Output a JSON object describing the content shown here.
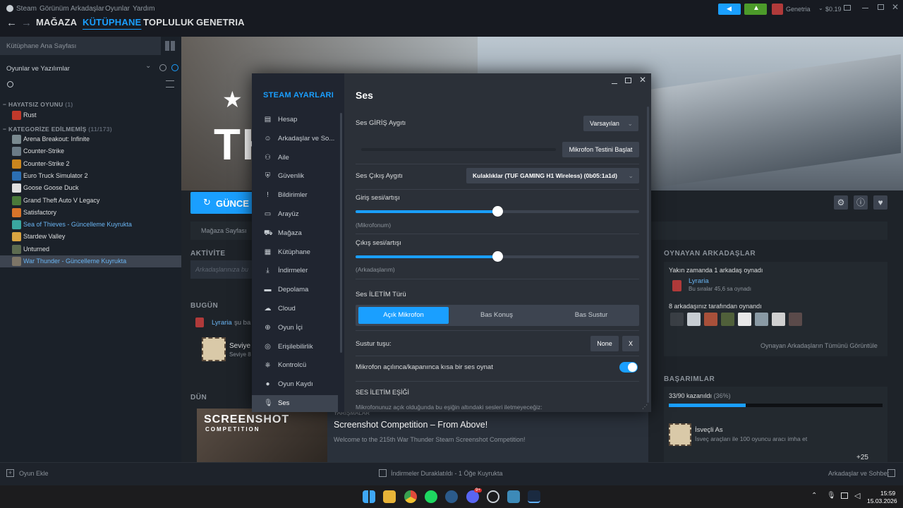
{
  "menubar": {
    "items": [
      "Steam",
      "Görünüm",
      "Arkadaşlar",
      "Oyunlar",
      "Yardım"
    ],
    "user": "Genetria",
    "balance": "$0.19"
  },
  "nav": {
    "back": "←",
    "forward": "→",
    "tabs": [
      "MAĞAZA",
      "KÜTÜPHANE",
      "TOPLULUK",
      "GENETRIA"
    ],
    "active_tab": "KÜTÜPHANE"
  },
  "sidebar": {
    "home": "Kütüphane Ana Sayfası",
    "filter": "Oyunlar ve Yazılımlar",
    "cat1": "HAYATSIZ OYUNU",
    "cat1_count": "(1)",
    "cat2": "KATEGORİZE EDİLMEMİŞ",
    "cat2_count": "(11/173)",
    "games": [
      {
        "name": "Rust",
        "status": "",
        "color": "#c0392b"
      },
      {
        "name": "Arena Breakout: Infinite",
        "status": "",
        "color": "#7a8a90"
      },
      {
        "name": "Counter-Strike",
        "status": "",
        "color": "#6b7b86"
      },
      {
        "name": "Counter-Strike 2",
        "status": "",
        "color": "#c9851e"
      },
      {
        "name": "Euro Truck Simulator 2",
        "status": "",
        "color": "#2c6fb3"
      },
      {
        "name": "Goose Goose Duck",
        "status": "",
        "color": "#e0e0e0"
      },
      {
        "name": "Grand Theft Auto V Legacy",
        "status": "",
        "color": "#4a7a3a"
      },
      {
        "name": "Satisfactory",
        "status": "",
        "color": "#d7742a"
      },
      {
        "name": "Sea of Thieves",
        "status": " - Güncelleme Kuyrukta",
        "color": "#3aa7a0"
      },
      {
        "name": "Stardew Valley",
        "status": "",
        "color": "#d9a441"
      },
      {
        "name": "Unturned",
        "status": "",
        "color": "#5d6b50"
      },
      {
        "name": "War Thunder",
        "status": " - Güncelleme Kuyrukta",
        "color": "#7d7567"
      }
    ]
  },
  "hero": {
    "title_partial": "TH",
    "update_button": "GÜNCE",
    "store_page": "Mağaza Sayfası",
    "activity": "AKTİVİTE",
    "activity_placeholder": "Arkadaşlarınıza bu",
    "today": "BUGÜN",
    "today_user": "Lyraria",
    "today_text": "şu ba",
    "today_item": "Seviye",
    "today_item_sub": "Seviye 8",
    "yesterday": "DÜN",
    "event_tag": "YARIŞMALAR",
    "event_title": "Screenshot Competition – From Above!",
    "event_desc": "Welcome to the 215th War Thunder Steam Screenshot Competition!",
    "event_img_title": "SCREENSHOT",
    "event_img_sub": "COMPETITION"
  },
  "friends_panel": {
    "title": "OYNAYAN ARKADAŞLAR",
    "recent": "Yakın zamanda 1 arkadaş oynadı",
    "friend_name": "Lyraria",
    "friend_sub": "Bu sıralar 45,6 sa oynadı",
    "played_by": "8 arkadaşınız tarafından oynandı",
    "view_all": "Oynayan Arkadaşların Tümünü Görüntüle",
    "avatar_colors": [
      "#3a3f45",
      "#c7cdd3",
      "#a8503a",
      "#50603a",
      "#e8e8e8",
      "#8a9aa5",
      "#d0d0d0",
      "#5a4a4a"
    ]
  },
  "achievements": {
    "title": "BAŞARIMLAR",
    "progress_text": "33/90 kazanıldı",
    "progress_pct": "(36%)",
    "progress": 0.36,
    "latest_name": "İsveçli As",
    "latest_desc": "İsveç araçları ile 100 oyuncu aracı imha et",
    "more": "+25"
  },
  "settings": {
    "title": "STEAM AYARLARI",
    "nav": [
      {
        "label": "Hesap",
        "icon": "▤"
      },
      {
        "label": "Arkadaşlar ve So...",
        "icon": "☺"
      },
      {
        "label": "Aile",
        "icon": "⚇"
      },
      {
        "label": "Güvenlik",
        "icon": "⛨"
      },
      {
        "label": "Bildirimler",
        "icon": "!"
      },
      {
        "label": "Arayüz",
        "icon": "▭"
      },
      {
        "label": "Mağaza",
        "icon": "⛟"
      },
      {
        "label": "Kütüphane",
        "icon": "▦"
      },
      {
        "label": "İndirmeler",
        "icon": "⤓"
      },
      {
        "label": "Depolama",
        "icon": "▬"
      },
      {
        "label": "Cloud",
        "icon": "☁"
      },
      {
        "label": "Oyun İçi",
        "icon": "⊕"
      },
      {
        "label": "Erişilebilirlik",
        "icon": "◎"
      },
      {
        "label": "Kontrolcü",
        "icon": "⎈"
      },
      {
        "label": "Oyun Kaydı",
        "icon": "●"
      },
      {
        "label": "Ses",
        "icon": "🎙"
      }
    ],
    "page_title": "Ses",
    "input_device_label": "Ses GİRİŞ Aygıtı",
    "input_device_value": "Varsayılan",
    "mic_test_button": "Mikrofon Testini Başlat",
    "output_device_label": "Ses Çıkış Aygıtı",
    "output_device_value": "Kulaklıklar (TUF GAMING H1 Wireless) (0b05:1a1d)",
    "input_volume_label": "Giriş sesi/artışı",
    "input_volume_sub": "(Mikrofonum)",
    "input_volume": 0.5,
    "output_volume_label": "Çıkış sesi/artışı",
    "output_volume_sub": "(Arkadaşlarım)",
    "output_volume": 0.5,
    "transmission_label": "Ses İLETİM Türü",
    "transmission_options": [
      "Açık Mikrofon",
      "Bas Konuş",
      "Bas Sustur"
    ],
    "transmission_selected": "Açık Mikrofon",
    "mute_key_label": "Sustur tuşu:",
    "mute_key_value": "None",
    "mute_key_clear": "X",
    "mic_sound_label": "Mikrofon açılınca/kapanınca kısa bir ses oynat",
    "mic_sound_on": true,
    "threshold_label": "SES İLETİM EŞİĞİ",
    "threshold_desc": "Mikrofonunuz açık olduğunda bu eşiğin altındaki sesleri iletmeyeceğiz:"
  },
  "bottombar": {
    "add_game": "Oyun Ekle",
    "downloads": "İndirmeler Duraklatıldı - 1 Öğe Kuyrukta",
    "friends_chat": "Arkadaşlar ve Sohbet"
  },
  "taskbar": {
    "time": "15:59",
    "date": "15.03.2026",
    "notif_badge": "9+"
  },
  "colors": {
    "accent": "#1a9fff",
    "bg": "#171d25",
    "panel": "#2b3038",
    "green": "#4c9a2a"
  }
}
